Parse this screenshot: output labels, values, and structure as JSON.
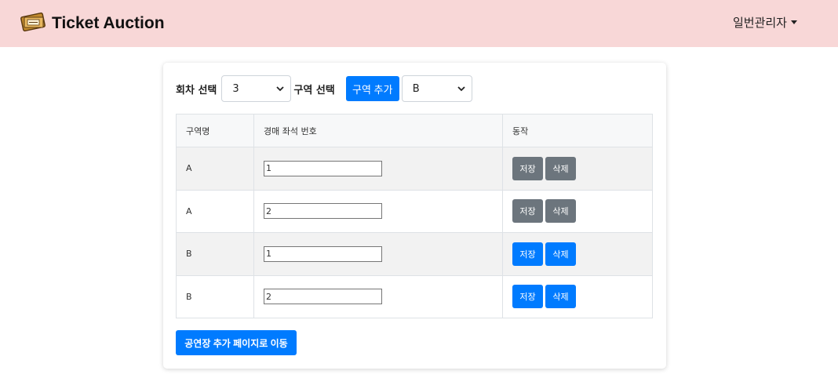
{
  "header": {
    "app_title": "Ticket Auction",
    "logo_icon": "ticket-icon",
    "user_menu": "일번관리자"
  },
  "filters": {
    "round_label": "회차 선택",
    "round_value": "3",
    "zone_label": "구역 선택",
    "add_zone_button": "구역 추가",
    "zone_value": "B"
  },
  "table": {
    "columns": [
      "구역명",
      "경매 좌석 번호",
      "동작"
    ],
    "rows": [
      {
        "zone": "A",
        "seat": "1",
        "save": "저장",
        "delete": "삭제",
        "style": "gray"
      },
      {
        "zone": "A",
        "seat": "2",
        "save": "저장",
        "delete": "삭제",
        "style": "gray"
      },
      {
        "zone": "B",
        "seat": "1",
        "save": "저장",
        "delete": "삭제",
        "style": "blue"
      },
      {
        "zone": "B",
        "seat": "2",
        "save": "저장",
        "delete": "삭제",
        "style": "blue"
      }
    ]
  },
  "footer": {
    "venue_page_button": "공연장 추가 페이지로 이동"
  },
  "colors": {
    "navbar_bg": "#f8d7d7",
    "primary": "#007bff",
    "secondary": "#6c757d"
  }
}
